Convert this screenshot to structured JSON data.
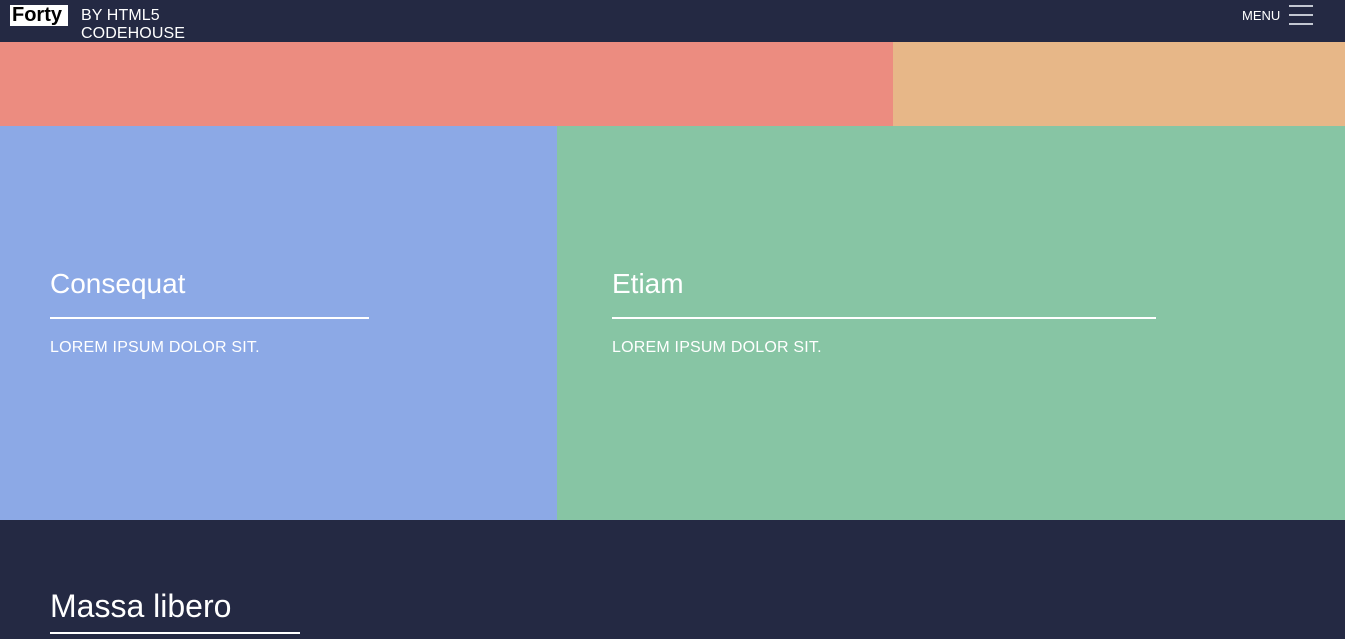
{
  "header": {
    "logo_strong": "Forty",
    "logo_sub": "BY HTML5 CODEHOUSE",
    "menu_label": "MENU",
    "menu_icon": "hamburger-menu-icon"
  },
  "tiles": [
    {
      "title": "",
      "subtitle": "",
      "color": "#ec8c80"
    },
    {
      "title": "",
      "subtitle": "",
      "color": "#e7b788"
    },
    {
      "title": "Consequat",
      "subtitle": "LOREM IPSUM DOLOR SIT.",
      "color": "#8ca9e6"
    },
    {
      "title": "Etiam",
      "subtitle": "LOREM IPSUM DOLOR SIT.",
      "color": "#87c5a4"
    }
  ],
  "section": {
    "title": "Massa libero"
  },
  "colors": {
    "background": "#242943",
    "text": "#ffffff"
  }
}
